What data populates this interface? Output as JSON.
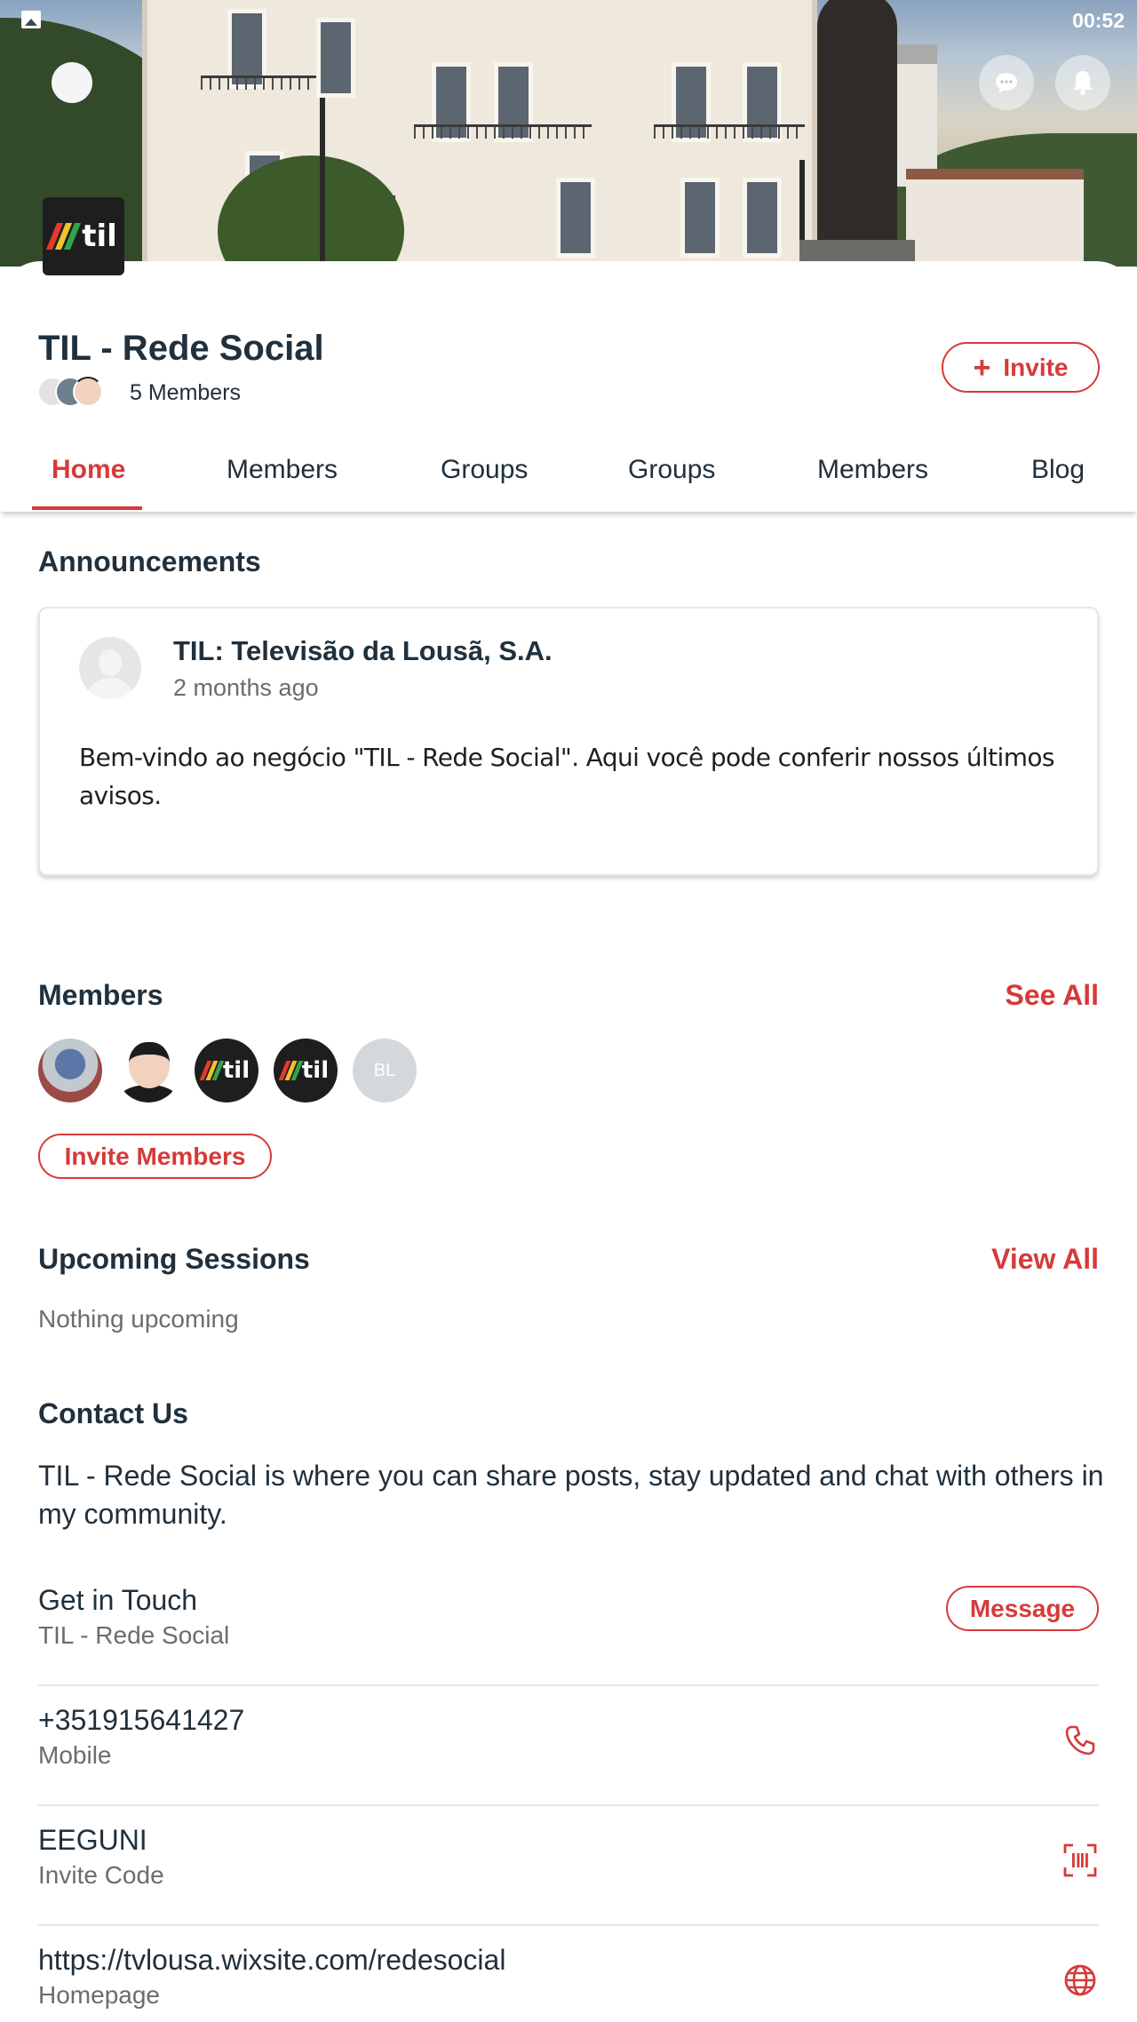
{
  "status_bar": {
    "time": "00:52"
  },
  "colors": {
    "accent": "#d63a3a",
    "text": "#20303c",
    "muted": "#6c6c6c"
  },
  "header": {
    "back_icon": "circle-back-icon",
    "chat_icon": "chat-bubble-icon",
    "bell_icon": "bell-icon",
    "logo_text": "til"
  },
  "group": {
    "title": "TIL - Rede Social",
    "members_count": "5 Members",
    "invite_label": "Invite"
  },
  "tabs": [
    {
      "label": "Home",
      "active": true
    },
    {
      "label": "Members"
    },
    {
      "label": "Groups"
    },
    {
      "label": "Groups"
    },
    {
      "label": "Members"
    },
    {
      "label": "Blog"
    }
  ],
  "announcements": {
    "heading": "Announcements",
    "post": {
      "author": "TIL: Televisão da Lousã, S.A.",
      "time": "2 months ago",
      "text": "Bem-vindo ao negócio \"TIL - Rede Social\". Aqui você pode conferir nossos últimos avisos."
    }
  },
  "members_section": {
    "heading": "Members",
    "see_all": "See All",
    "avatars": [
      {
        "kind": "photo"
      },
      {
        "kind": "cartoon"
      },
      {
        "kind": "logo",
        "text": "til"
      },
      {
        "kind": "logo",
        "text": "til"
      },
      {
        "kind": "initials",
        "text": "BL"
      }
    ],
    "invite_label": "Invite Members"
  },
  "sessions": {
    "heading": "Upcoming Sessions",
    "view_all": "View All",
    "empty": "Nothing upcoming"
  },
  "contact": {
    "heading": "Contact Us",
    "about": "TIL - Rede Social is where you can share posts, stay updated and chat with others in my community.",
    "rows": [
      {
        "main": "Get in Touch",
        "sub": "TIL - Rede Social",
        "action_label": "Message"
      },
      {
        "main": "+351915641427",
        "sub": "Mobile",
        "icon": "phone-icon"
      },
      {
        "main": "EEGUNI",
        "sub": "Invite Code",
        "icon": "barcode-scan-icon"
      },
      {
        "main": "https://tvlousa.wixsite.com/redesocial",
        "sub": "Homepage",
        "icon": "globe-icon"
      }
    ]
  }
}
